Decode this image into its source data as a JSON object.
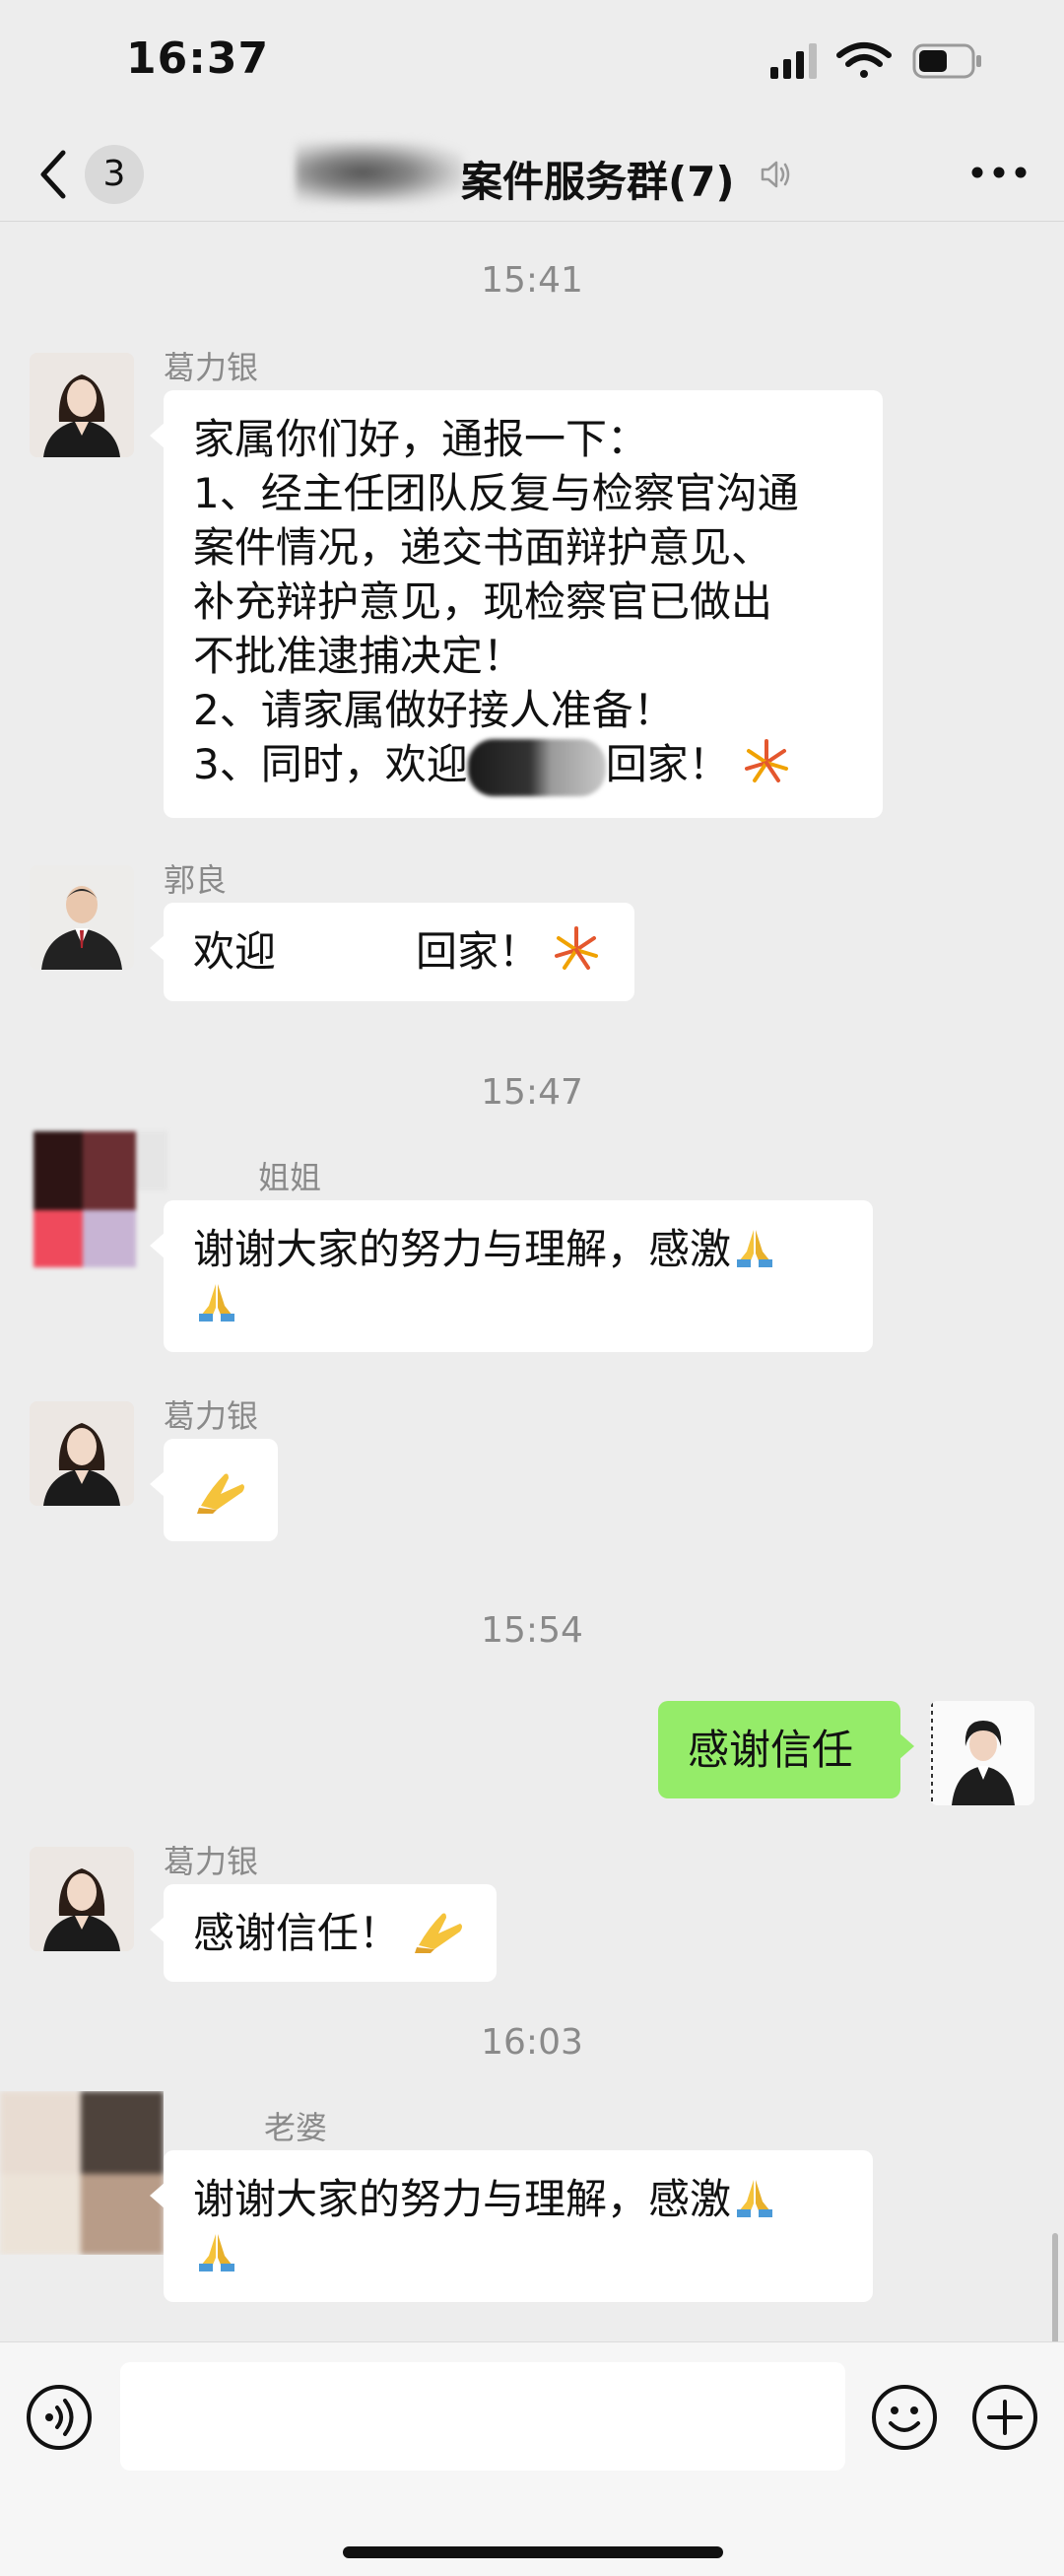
{
  "status_bar": {
    "time": "16:37"
  },
  "nav": {
    "unread_count": "3",
    "title": "案件服务群(7)"
  },
  "messages": {
    "t1": "15:41",
    "m1": {
      "sender": "葛力银",
      "lines": [
        "家属你们好，通报一下：",
        "1、经主任团队反复与检察官沟通",
        "案件情况，递交书面辩护意见、",
        "补充辩护意见，现检察官已做出",
        "不批准逮捕决定！",
        "2、请家属做好接人准备！"
      ],
      "last_prefix": "3、同时，欢迎",
      "last_suffix": "回家！"
    },
    "m2": {
      "sender": "郭良",
      "prefix": "欢迎",
      "suffix": "回家！"
    },
    "t2": "15:47",
    "m3": {
      "sender": "姐姐",
      "line1": "谢谢大家的努力与理解，感激"
    },
    "m4": {
      "sender": "葛力银"
    },
    "t3": "15:54",
    "m5": {
      "text": "感谢信任"
    },
    "m6": {
      "sender": "葛力银",
      "text": "感谢信任！"
    },
    "t4": "16:03",
    "m7": {
      "sender": "老婆",
      "line1": "谢谢大家的努力与理解，感激"
    }
  },
  "colors": {
    "background": "#ededed",
    "bubble_other": "#ffffff",
    "bubble_self": "#95ec69",
    "meta_text": "#8a8a8a"
  },
  "icons": {
    "back": "chevron-left-icon",
    "voice_muted": "speaker-icon",
    "more": "ellipsis-icon",
    "fireworks": "fireworks-emoji",
    "pray": "folded-hands-emoji",
    "voice_input": "voice-input-icon",
    "emoji_picker": "smiley-icon",
    "plus": "plus-icon"
  }
}
